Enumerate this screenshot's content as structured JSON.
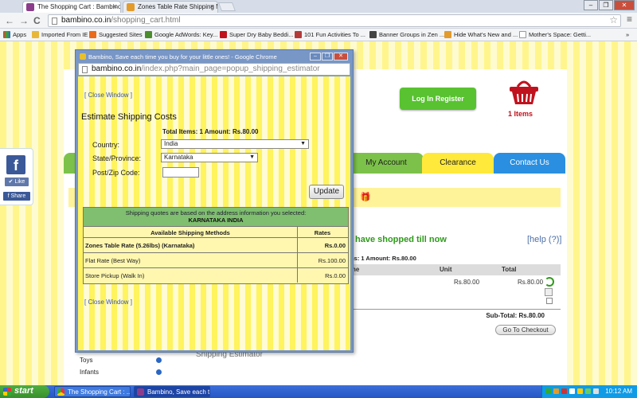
{
  "browser": {
    "tabs": [
      {
        "label": "The Shopping Cart : Bambino",
        "close": "×"
      },
      {
        "label": "Zones Table Rate Shipping M",
        "close": "×"
      }
    ],
    "nav": {
      "back": "←",
      "forward": "→",
      "reload": "C"
    },
    "url_host": "bambino.co.in",
    "url_path": "/shopping_cart.html",
    "bookmarks": [
      "Apps",
      "Imported From IE",
      "Suggested Sites",
      "Google AdWords: Key...",
      "Super Dry Baby Beddi...",
      "101 Fun Activities To ...",
      "Banner Groups in Zen ...",
      "Hide What's New and ...",
      "Mother's Space: Getti..."
    ],
    "window_buttons": {
      "minimize": "–",
      "restore": "❐",
      "close": "✕"
    }
  },
  "site": {
    "login_label": "Log In   Register",
    "cart_count": "1 Items",
    "nav_tabs": [
      "My Account",
      "Clearance",
      "Contact Us"
    ],
    "shopped_heading": "have shopped till now",
    "help_link": "[help (?)]",
    "summary": "ms: 1  Amount: Rs.80.00",
    "cart_headers": {
      "name": "ne",
      "unit": "Unit",
      "total": "Total"
    },
    "cart_row": {
      "unit": "Rs.80.00",
      "total": "Rs.80.00"
    },
    "subtotal": "Sub-Total: Rs.80.00",
    "checkout": "Go To Checkout",
    "shipping_estimator": "Shipping Estimator",
    "sidebar_categories": [
      "Toys",
      "Infants"
    ]
  },
  "facebook": {
    "icon": "f",
    "like": "✔ Like",
    "share": "f Share"
  },
  "popup": {
    "title": "Bambino, Save each time you buy for your little ones! - Google Chrome",
    "url_host": "bambino.co.in",
    "url_path": "/index.php?main_page=popup_shipping_estimator",
    "close_window": "[ Close Window ]",
    "heading": "Estimate Shipping Costs",
    "totals": "Total Items: 1  Amount: Rs.80.00",
    "country_label": "Country:",
    "country_value": "India",
    "state_label": "State/Province:",
    "state_value": "Karnataka",
    "zip_label": "Post/Zip Code:",
    "zip_value": "",
    "update_label": "Update",
    "note": "Shipping quotes are based on the address information you selected:",
    "note_address": "KARNATAKA INDIA",
    "table_headers": {
      "method": "Available Shipping Methods",
      "rate": "Rates"
    },
    "methods": [
      {
        "name": "Zones Table Rate (5.26lbs) (Karnataka)",
        "rate": "Rs.0.00"
      },
      {
        "name": "Flat Rate (Best Way)",
        "rate": "Rs.100.00"
      },
      {
        "name": "Store Pickup (Walk In)",
        "rate": "Rs.0.00"
      }
    ],
    "close_window_bottom": "[ Close Window ]"
  },
  "taskbar": {
    "start": "start",
    "buttons": [
      "The Shopping Cart : ...",
      "Bambino, Save each t..."
    ],
    "clock": "10:12 AM"
  },
  "colors": {
    "green_button": "#58c230",
    "page_stripe": "#fff58c",
    "popup_frame": "#7896c6",
    "taskbar": "#2456c6"
  }
}
